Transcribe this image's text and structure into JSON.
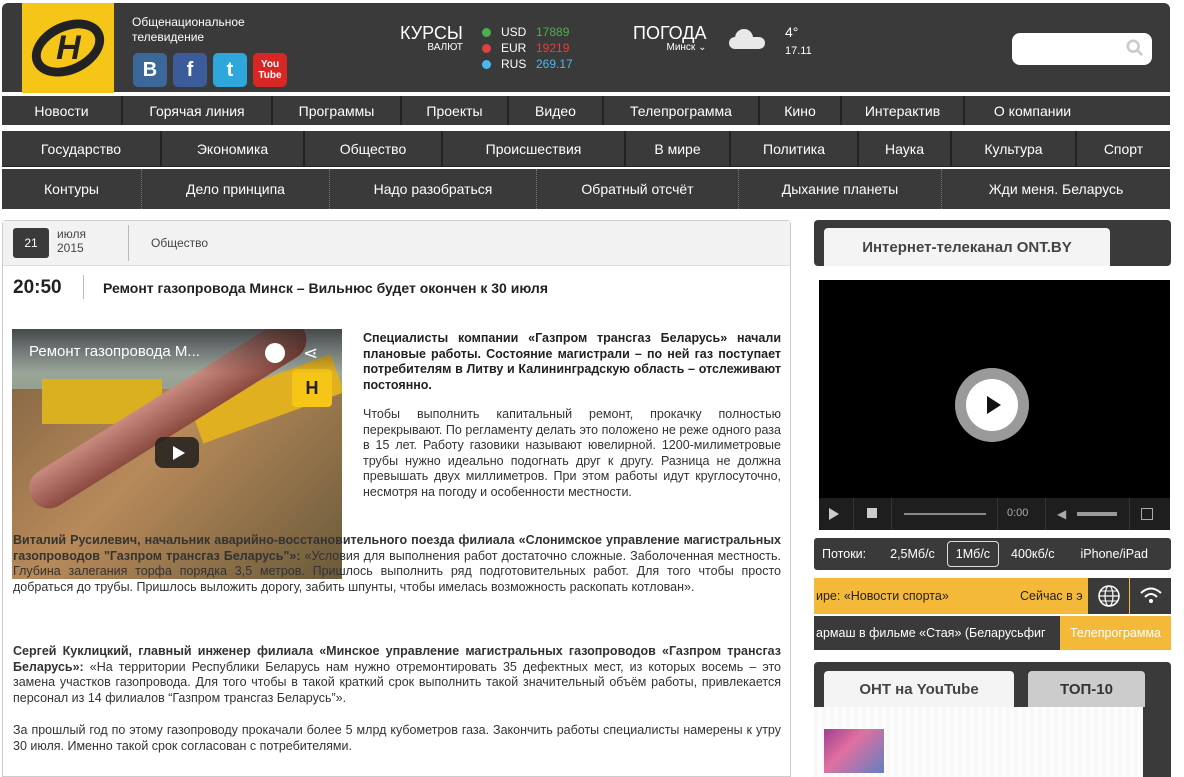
{
  "header": {
    "logo_letter": "Н",
    "org_name": "Общенациональное телевидение",
    "socials": [
      {
        "name": "vk",
        "label": "В"
      },
      {
        "name": "facebook",
        "label": "f"
      },
      {
        "name": "twitter",
        "label": "t"
      },
      {
        "name": "youtube",
        "label_top": "You",
        "label_bottom": "Tube"
      }
    ],
    "rates_title": "КУРСЫ",
    "rates_subtitle": "ВАЛЮТ",
    "rates": [
      {
        "code": "USD",
        "value": "17889",
        "color": "#4caf50"
      },
      {
        "code": "EUR",
        "value": "19219",
        "color": "#e04040"
      },
      {
        "code": "RUS",
        "value": "269.17",
        "color": "#4ab8f0"
      }
    ],
    "weather_title": "ПОГОДА",
    "weather_city": "Минск",
    "temperature": "4°",
    "weather_date": "17.11",
    "search_placeholder": ""
  },
  "nav_main": [
    "Новости",
    "Горячая линия",
    "Программы",
    "Проекты",
    "Видео",
    "Телепрограмма",
    "Кино",
    "Интерактив",
    "О компании"
  ],
  "nav_categories": [
    "Государство",
    "Экономика",
    "Общество",
    "Происшествия",
    "В мире",
    "Политика",
    "Наука",
    "Культура",
    "Спорт"
  ],
  "nav_programs": [
    "Контуры",
    "Дело принципа",
    "Надо разобраться",
    "Обратный отсчёт",
    "Дыхание планеты",
    "Жди меня. Беларусь"
  ],
  "article": {
    "day": "21",
    "month": "июля",
    "year": "2015",
    "category": "Общество",
    "time": "20:50",
    "headline": "Ремонт газопровода Минск – Вильнюс будет окончен к 30 июля",
    "video_title": "Ремонт газопровода М...",
    "lead": "Специалисты компании «Газпром трансгаз Беларусь» начали плановые работы. Состояние магистрали – по ней газ поступает потребителям в Литву и Калининградскую область – отслеживают постоянно.",
    "p1": "Чтобы выполнить капитальный ремонт, прокачку полностью перекрывают. По регламенту делать это положено не реже одного раза в 15 лет. Работу газовики называют ювелирной. 1200-милиметровые трубы нужно идеально подогнать друг к другу. Разница не должна превышать двух миллиметров. При этом работы идут круглосуточно, несмотря на погоду и особенности местности.",
    "p2_bold": "Виталий Русилевич, начальник аварийно-восстановительного поезда филиала «Слонимское управление магистральных газопроводов \"Газпром трансгаз Беларусь\"»:",
    "p2_text": " «Условия для выполнения работ достаточно сложные. Заболоченная местность. Глубина залегания торфа порядка 3,5 метров. Пришлось выполнить ряд подготовительных работ. Для того чтобы просто добраться до трубы. Пришлось выложить дорогу, забить шпунты, чтобы имелась возможность раскопать котлован».",
    "p3_bold": "Сергей Куклицкий, главный инженер филиала «Минское управление магистральных газопроводов «Газпром трансгаз Беларусь»:",
    "p3_text": " «На территории Республики Беларусь нам нужно отремонтировать 35 дефектных мест, из которых восемь – это замена участков газопровода. Для того чтобы в такой краткий срок выполнить такой значительный объём работы, привлекается персонал из 14 филиалов “Газпром трансгаз Беларусь”».",
    "p4": "За прошлый год по этому газопроводу прокачали более 5 млрд кубометров газа. Закончить работы специалисты намерены к утру 30 июля. Именно такой срок согласован с потребителями."
  },
  "sidebar": {
    "live_tab": "Интернет-телеканал ONT.BY",
    "player_time": "0:00",
    "streams_label": "Потоки:",
    "streams": [
      "2,5Мб/с",
      "1Мб/с",
      "400кб/с",
      "iPhone/iPad"
    ],
    "stream_selected": "1Мб/с",
    "ticker_now": "ире: «Новости спорта»",
    "ticker_next": "Сейчас в э",
    "ticker2_text": "армаш в фильме «Стая» (Беларусьфиг",
    "tv_button": "Телепрограмма",
    "yt_tab": "ОНТ на YouTube",
    "top_tab": "ТОП-10"
  }
}
